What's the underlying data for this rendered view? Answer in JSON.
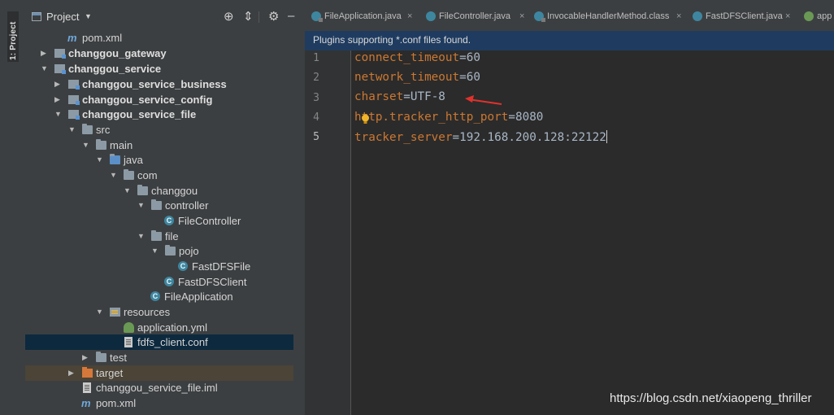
{
  "sidebar_stripe": {
    "label": "1: Project"
  },
  "project_panel": {
    "title": "Project",
    "tree": [
      {
        "label": "pom.xml",
        "kind": "maven"
      },
      {
        "label": "changgou_gateway",
        "kind": "module"
      },
      {
        "label": "changgou_service",
        "kind": "module"
      },
      {
        "label": "changgou_service_business",
        "kind": "module"
      },
      {
        "label": "changgou_service_config",
        "kind": "module"
      },
      {
        "label": "changgou_service_file",
        "kind": "module"
      },
      {
        "label": "src",
        "kind": "folder"
      },
      {
        "label": "main",
        "kind": "folder"
      },
      {
        "label": "java",
        "kind": "folder"
      },
      {
        "label": "com",
        "kind": "package"
      },
      {
        "label": "changgou",
        "kind": "package"
      },
      {
        "label": "controller",
        "kind": "package"
      },
      {
        "label": "FileController",
        "kind": "class"
      },
      {
        "label": "file",
        "kind": "package"
      },
      {
        "label": "pojo",
        "kind": "package"
      },
      {
        "label": "FastDFSFile",
        "kind": "class"
      },
      {
        "label": "FastDFSClient",
        "kind": "class"
      },
      {
        "label": "FileApplication",
        "kind": "class"
      },
      {
        "label": "resources",
        "kind": "resources"
      },
      {
        "label": "application.yml",
        "kind": "yml"
      },
      {
        "label": "fdfs_client.conf",
        "kind": "file",
        "selected": true
      },
      {
        "label": "test",
        "kind": "folder"
      },
      {
        "label": "target",
        "kind": "target"
      },
      {
        "label": "changgou_service_file.iml",
        "kind": "file"
      },
      {
        "label": "pom.xml",
        "kind": "maven"
      }
    ]
  },
  "editor": {
    "tabs": [
      {
        "label": "FileApplication.java"
      },
      {
        "label": "FileController.java"
      },
      {
        "label": "InvocableHandlerMethod.class"
      },
      {
        "label": "FastDFSClient.java"
      },
      {
        "label": "app"
      }
    ],
    "notice": "Plugins supporting *.conf files found.",
    "lines": [
      {
        "num": "1",
        "key": "connect_timeout",
        "eq": "=",
        "val": "60"
      },
      {
        "num": "2",
        "key": "network_timeout",
        "eq": "=",
        "val": "60"
      },
      {
        "num": "3",
        "key": "charset",
        "eq": "=",
        "val": "UTF-8"
      },
      {
        "num": "4",
        "key": "http.tracker_http_port",
        "eq": "=",
        "val": "8080"
      },
      {
        "num": "5",
        "key": "tracker_server",
        "eq": "=",
        "val": "192.168.200.128:22122"
      }
    ],
    "close_glyph": "×"
  },
  "watermark": "https://blog.csdn.net/xiaopeng_thriller",
  "colors": {
    "key": "#cc7832",
    "value": "#a9b7c6",
    "selection": "#0d293e",
    "notice_bg": "#1f3c60",
    "arrow": "#e0322c"
  }
}
